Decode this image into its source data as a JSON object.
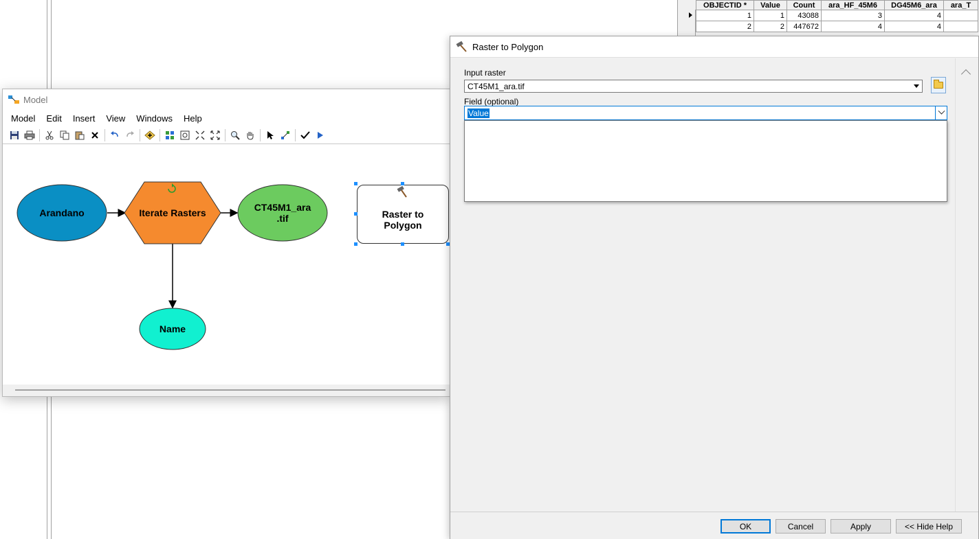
{
  "attribute_table": {
    "columns": [
      "OBJECTID *",
      "Value",
      "Count",
      "ara_HF_45M6",
      "DG45M6_ara",
      "ara_T"
    ],
    "rows": [
      [
        "1",
        "1",
        "43088",
        "3",
        "4",
        ""
      ],
      [
        "2",
        "2",
        "447672",
        "4",
        "4",
        ""
      ]
    ]
  },
  "model_window": {
    "title": "Model",
    "menu": [
      "Model",
      "Edit",
      "Insert",
      "View",
      "Windows",
      "Help"
    ],
    "toolbar_icons": [
      "save-icon",
      "print-icon",
      "cut-icon",
      "copy-icon",
      "paste-icon",
      "delete-icon",
      "undo-icon",
      "redo-icon",
      "add-data-icon",
      "auto-layout-icon",
      "full-extent-icon",
      "fixed-zoom-in-icon",
      "fixed-zoom-out-icon",
      "zoom-icon",
      "pan-icon",
      "select-icon",
      "connect-icon",
      "validate-icon",
      "run-icon"
    ],
    "nodes": {
      "arandano": "Arandano",
      "iterate_rasters": "Iterate Rasters",
      "ct45m1_line1": "CT45M1_ara",
      "ct45m1_line2": ".tif",
      "name": "Name",
      "raster_to_polygon_line1": "Raster to",
      "raster_to_polygon_line2": "Polygon"
    },
    "colors": {
      "arandano": "#0a8fc4",
      "iterate": "#f58a2e",
      "ct45m1": "#6ccb5f",
      "name": "#11f0d0"
    }
  },
  "dialog": {
    "title": "Raster to Polygon",
    "input_raster_label": "Input raster",
    "input_raster_value": "CT45M1_ara.tif",
    "field_label": "Field (optional)",
    "field_value": "Value",
    "buttons": {
      "ok": "OK",
      "cancel": "Cancel",
      "apply": "Apply",
      "hide_help": "<< Hide Help"
    }
  }
}
